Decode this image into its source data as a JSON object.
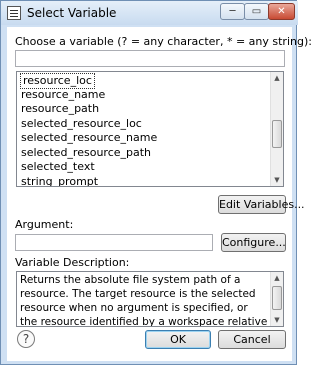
{
  "window": {
    "title": "Select Variable",
    "min_glyph": "─",
    "max_glyph": "▭",
    "close_glyph": "✕"
  },
  "filter": {
    "label": "Choose a variable (? = any character, * = any string):",
    "value": ""
  },
  "variables": [
    {
      "name": "resource_loc",
      "selected": true
    },
    {
      "name": "resource_name",
      "selected": false
    },
    {
      "name": "resource_path",
      "selected": false
    },
    {
      "name": "selected_resource_loc",
      "selected": false
    },
    {
      "name": "selected_resource_name",
      "selected": false
    },
    {
      "name": "selected_resource_path",
      "selected": false
    },
    {
      "name": "selected_text",
      "selected": false
    },
    {
      "name": "string_prompt",
      "selected": false
    }
  ],
  "buttons": {
    "edit_variables": "Edit Variables...",
    "configure": "Configure...",
    "ok": "OK",
    "cancel": "Cancel"
  },
  "argument": {
    "label": "Argument:",
    "value": ""
  },
  "description": {
    "label": "Variable Description:",
    "text": "Returns the absolute file system path of a resource. The target resource is the selected resource when no argument is specified, or the resource identified by a workspace relative"
  },
  "help": {
    "glyph": "?"
  },
  "icons": {
    "app": "window-icon",
    "help": "help-icon"
  }
}
